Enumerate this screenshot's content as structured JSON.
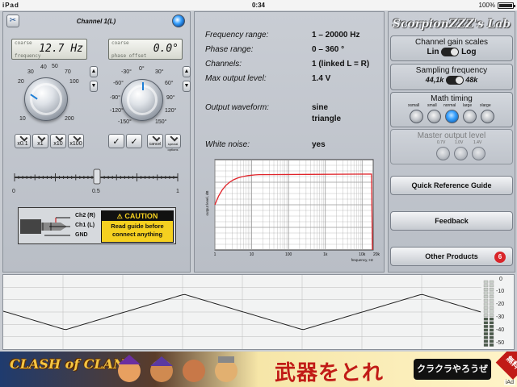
{
  "status_bar": {
    "left": "iPad",
    "time": "0:34",
    "battery": "100%"
  },
  "channel": {
    "title": "Channel 1(L)",
    "coarse_label": "coarse",
    "frequency": {
      "value": "12.7 Hz",
      "sub": "frequency"
    },
    "phase": {
      "value": "0.0°",
      "sub": "phase offset"
    },
    "freq_ticks": [
      "10",
      "20",
      "30",
      "40",
      "50",
      "70",
      "100",
      "200"
    ],
    "phase_ticks": [
      "-150°",
      "-120°",
      "-90°",
      "-60°",
      "-30°",
      "0°",
      "30°",
      "60°",
      "90°",
      "120°",
      "150°"
    ],
    "mult_buttons": [
      "x0.1",
      "x1",
      "x10",
      "x100"
    ],
    "phase_buttons": [
      "cancel",
      "special options"
    ],
    "slider_labels": [
      "0",
      "0.5",
      "1"
    ]
  },
  "caution": {
    "title": "CAUTION",
    "text": "Read guide before connect anything",
    "ch2": "Ch2 (R)",
    "ch1": "Ch1 (L)",
    "gnd": "GND"
  },
  "specs": [
    {
      "label": "Frequency range:",
      "value": "1 – 20000 Hz"
    },
    {
      "label": "Phase range:",
      "value": "0 – 360 °"
    },
    {
      "label": "Channels:",
      "value": "1 (linked L = R)"
    },
    {
      "label": "Max output level:",
      "value": "1.4 V"
    }
  ],
  "waveform": {
    "label": "Output waveform:",
    "values": [
      "sine",
      "triangle"
    ]
  },
  "white_noise": {
    "label": "White noise:",
    "value": "yes"
  },
  "freq_chart": {
    "ylabel": "output level, dB",
    "xlabel": "frequency, Hz",
    "xticks": [
      "1",
      "10",
      "100",
      "1k",
      "10k",
      "20k"
    ]
  },
  "brand": "ScorpionZZZ's Lab",
  "gain_scales": {
    "title": "Channel gain scales",
    "left": "Lin",
    "right": "Log"
  },
  "sampling": {
    "title": "Sampling frequency",
    "left": "44,1k",
    "right": "48k"
  },
  "math_timing": {
    "title": "Math timing",
    "options": [
      "xsmall",
      "small",
      "normal",
      "large",
      "xlarge"
    ],
    "selected": 2
  },
  "master_output": {
    "title": "Master output level",
    "options": [
      "0.7V",
      "1.0V",
      "1.4V"
    ]
  },
  "buttons": {
    "guide": "Quick Reference Guide",
    "feedback": "Feedback",
    "other": "Other Products",
    "other_badge": "6"
  },
  "vu_scale": [
    "0",
    "-10",
    "-20",
    "-30",
    "-40",
    "-50"
  ],
  "ad": {
    "title": "CLASH of CLANS",
    "slogan": "武器をとれ",
    "cta": "クラクラやろうぜ",
    "free": "無料",
    "tag": "iAd"
  },
  "colors": {
    "accent": "#1e7fd6",
    "chart_line": "#e0242a",
    "badge": "#d9252a"
  }
}
